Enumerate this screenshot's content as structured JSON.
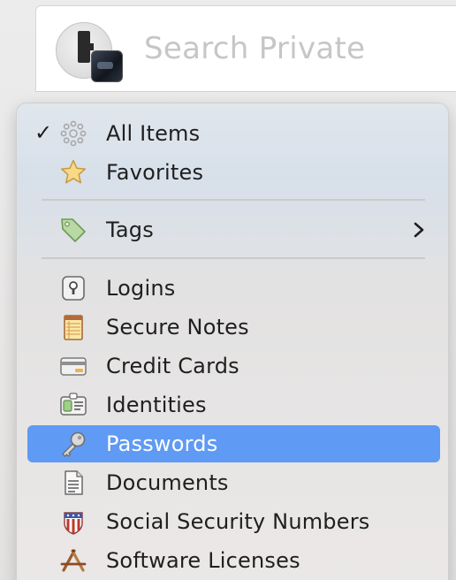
{
  "search": {
    "placeholder": "Search Private",
    "vault_icon": "private-vault-icon"
  },
  "menu": {
    "items": [
      {
        "key": "all-items",
        "label": "All Items",
        "icon": "all-items-icon",
        "checked": true
      },
      {
        "key": "favorites",
        "label": "Favorites",
        "icon": "star-icon"
      },
      {
        "key": "tags",
        "label": "Tags",
        "icon": "tag-icon",
        "submenu": true
      },
      {
        "key": "logins",
        "label": "Logins",
        "icon": "keyhole-icon"
      },
      {
        "key": "secure-notes",
        "label": "Secure Notes",
        "icon": "notepad-icon"
      },
      {
        "key": "credit-cards",
        "label": "Credit Cards",
        "icon": "credit-card-icon"
      },
      {
        "key": "identities",
        "label": "Identities",
        "icon": "id-card-icon"
      },
      {
        "key": "passwords",
        "label": "Passwords",
        "icon": "key-icon",
        "selected": true
      },
      {
        "key": "documents",
        "label": "Documents",
        "icon": "document-icon"
      },
      {
        "key": "ssn",
        "label": "Social Security Numbers",
        "icon": "ssn-shield-icon"
      },
      {
        "key": "software-licenses",
        "label": "Software Licenses",
        "icon": "app-store-icon"
      }
    ]
  },
  "colors": {
    "selection": "#5f9af4",
    "menu_background": "#ebe8e7",
    "placeholder_text": "#c6c6c6"
  }
}
